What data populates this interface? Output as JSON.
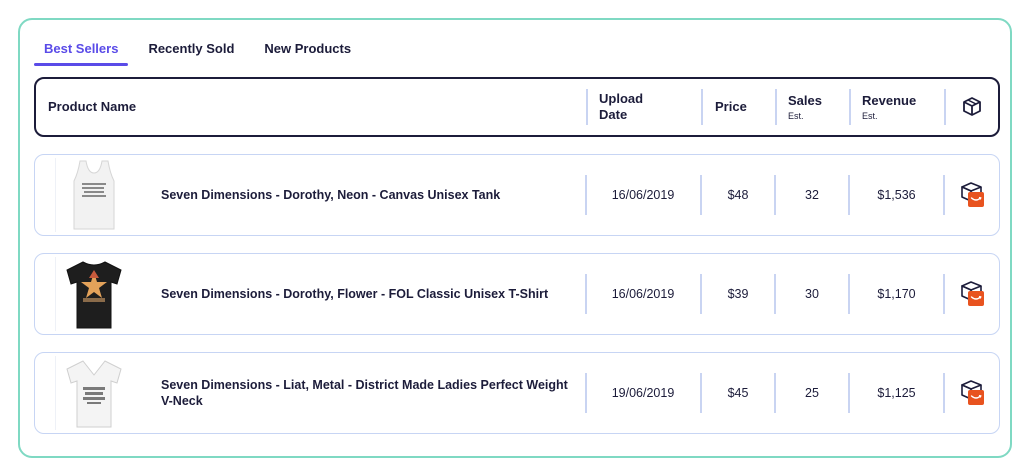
{
  "tabs": [
    {
      "label": "Best Sellers",
      "active": true
    },
    {
      "label": "Recently Sold",
      "active": false
    },
    {
      "label": "New Products",
      "active": false
    }
  ],
  "table": {
    "headers": {
      "product_name": "Product Name",
      "upload_date": "Upload Date",
      "price": "Price",
      "sales": "Sales",
      "sales_sub": "Est.",
      "revenue": "Revenue",
      "revenue_sub": "Est.",
      "box_icon": "box-icon"
    },
    "rows": [
      {
        "product_name": "Seven Dimensions - Dorothy, Neon - Canvas Unisex Tank",
        "upload_date": "16/06/2019",
        "price": "$48",
        "sales": "32",
        "revenue": "$1,536",
        "thumbnail": "white-tank-top-image",
        "action_icon": "amazon-box-icon"
      },
      {
        "product_name": "Seven Dimensions - Dorothy, Flower - FOL Classic Unisex T-Shirt",
        "upload_date": "16/06/2019",
        "price": "$39",
        "sales": "30",
        "revenue": "$1,170",
        "thumbnail": "black-tshirt-image",
        "action_icon": "amazon-box-icon"
      },
      {
        "product_name": "Seven Dimensions - Liat, Metal - District Made Ladies Perfect Weight V-Neck",
        "upload_date": "19/06/2019",
        "price": "$45",
        "sales": "25",
        "revenue": "$1,125",
        "thumbnail": "white-vneck-image",
        "action_icon": "amazon-box-icon"
      }
    ]
  },
  "colors": {
    "accent": "#5a4be8",
    "card_border": "#7fd9c3",
    "header_border": "#1c1c3a",
    "row_border": "#c7d5f4",
    "icon_orange": "#e8531f"
  }
}
